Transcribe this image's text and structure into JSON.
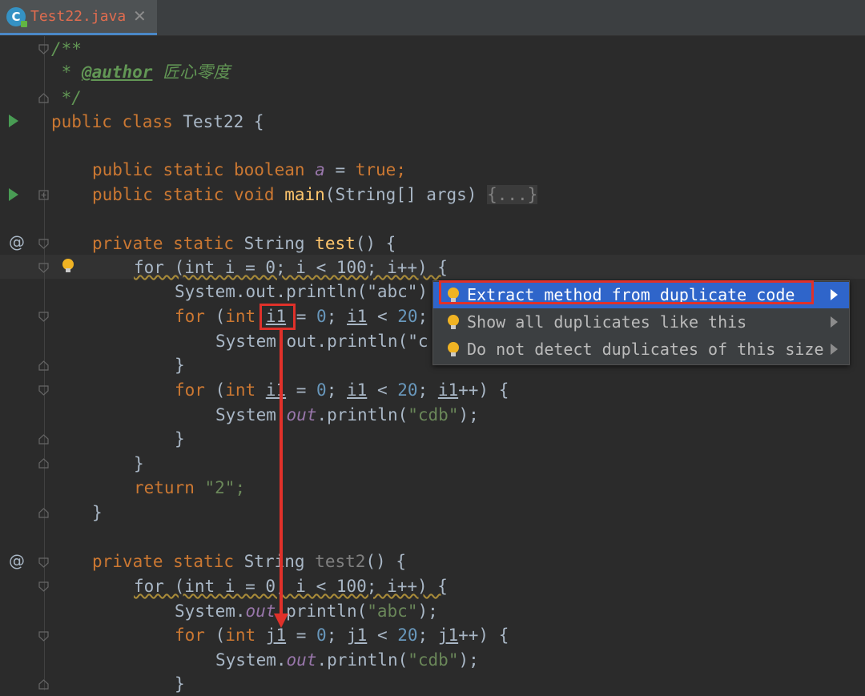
{
  "tab": {
    "title": "Test22.java",
    "icon_letter": "C",
    "close": "✕"
  },
  "code": {
    "l1": "/**",
    "l2_star": " * ",
    "l2_tag": "@author",
    "l2_name": " 匠心零度",
    "l3": " */",
    "l4_kw": "public class ",
    "l4_rest": "Test22 {",
    "l6_kw": "public static boolean ",
    "l6_var": "a",
    "l6_eq": " = ",
    "l6_val": "true;",
    "l7_kw": "public static void ",
    "l7_fn": "main",
    "l7_rest": "(String[] args) ",
    "l7_fold": "{...}",
    "l9_kw": "private static ",
    "l9_type": "String ",
    "l9_fn": "test",
    "l9_rest": "() {",
    "for1": "for (int i = 0; i < 100; i++) {",
    "sys_abc": "System.out.println(\"abc\");",
    "sys_abc_trunc": "System.out.println(\"abc\")",
    "for_i1_a": "for (int i1 = 0; i1 < 20; i1++) {",
    "sys_cdb_trunc": "System.out.println(\"c",
    "sys_cdb": "System.out.println(\"cdb\");",
    "brace": "}",
    "ret_kw": "return ",
    "ret_val": "\"2\";",
    "test2_fn": "test2",
    "for_j1": "for (int j1 = 0; j1 < 20; j1++) {"
  },
  "popup": {
    "items": [
      {
        "label": "Extract method from duplicate code",
        "selected": true
      },
      {
        "label": "Show all duplicates like this",
        "selected": false
      },
      {
        "label": "Do not detect duplicates of this size",
        "selected": false
      }
    ]
  },
  "colors": {
    "accent_red": "#e0312a",
    "selection_blue": "#2f65ca",
    "bulb": "#f0b323"
  }
}
